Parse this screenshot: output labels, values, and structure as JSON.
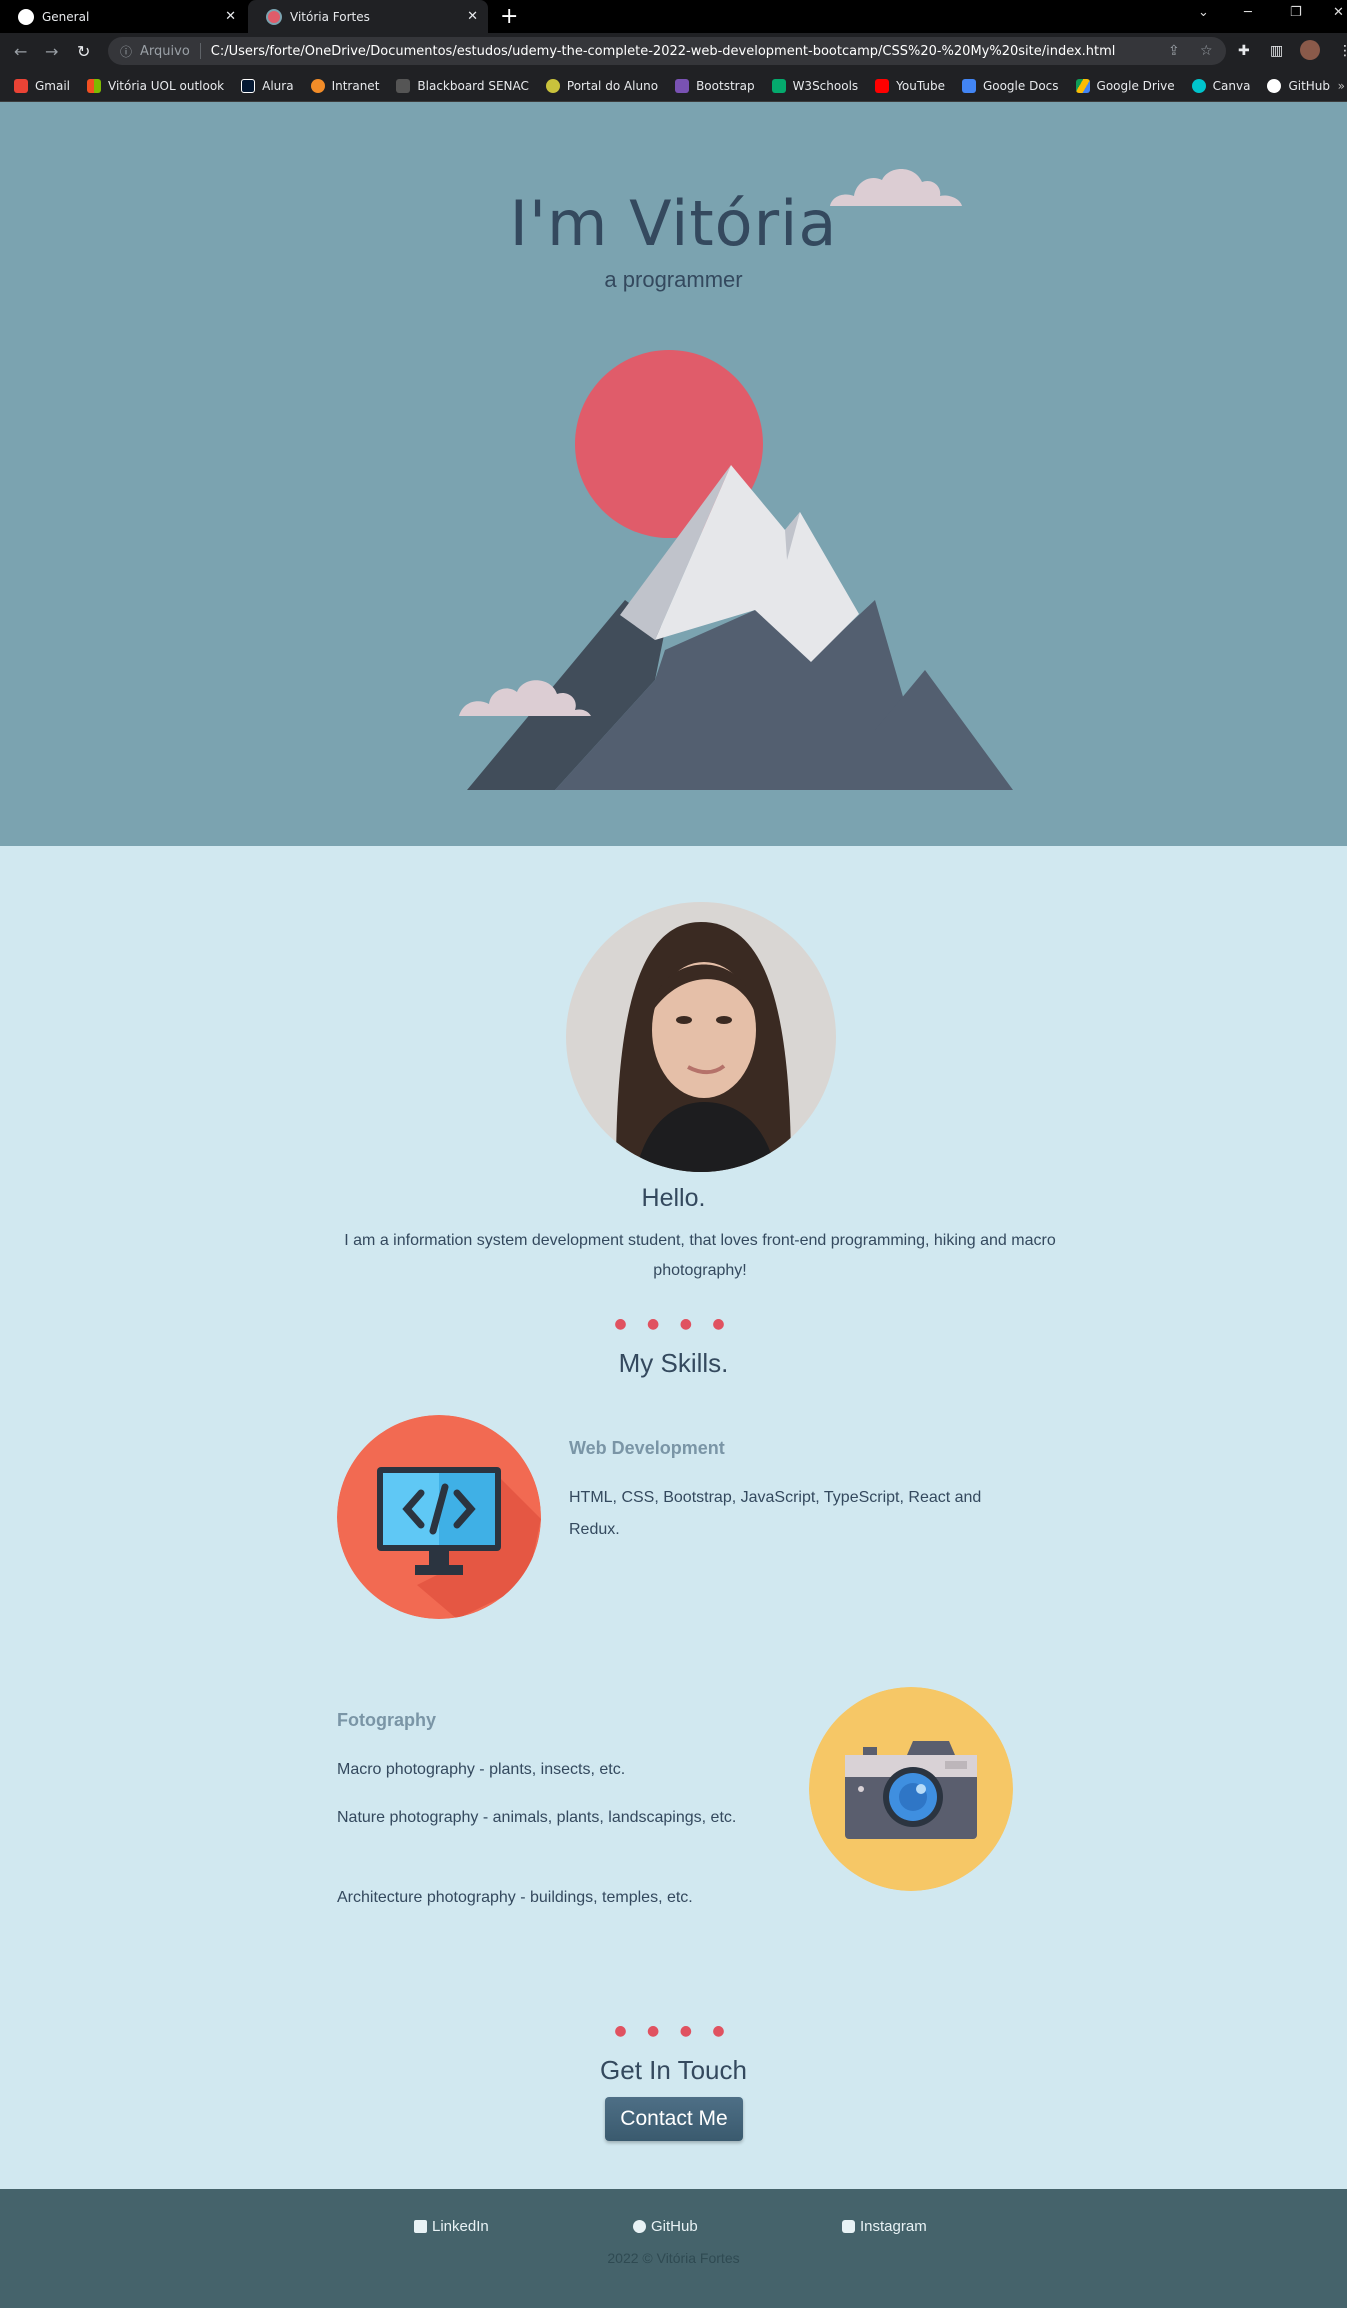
{
  "browser": {
    "tabs": [
      {
        "title": "General",
        "active": false
      },
      {
        "title": "Vitória Fortes",
        "active": true
      }
    ],
    "omnibox": {
      "security_label": "Arquivo",
      "url": "C:/Users/forte/OneDrive/Documentos/estudos/udemy-the-complete-2022-web-development-bootcamp/CSS%20-%20My%20site/index.html"
    },
    "bookmarks": [
      {
        "label": "Gmail",
        "icon": "gmail-icon",
        "color": "#ea4335"
      },
      {
        "label": "Vitória UOL outlook",
        "icon": "microsoft-icon",
        "color": "#f25022"
      },
      {
        "label": "Alura",
        "icon": "alura-icon",
        "color": "#051933"
      },
      {
        "label": "Intranet",
        "icon": "intranet-icon",
        "color": "#f28c28"
      },
      {
        "label": "Blackboard SENAC",
        "icon": "blackboard-icon",
        "color": "#555555"
      },
      {
        "label": "Portal do Aluno",
        "icon": "portal-icon",
        "color": "#c9c23c"
      },
      {
        "label": "Bootstrap",
        "icon": "bootstrap-icon",
        "color": "#7952b3"
      },
      {
        "label": "W3Schools",
        "icon": "w3schools-icon",
        "color": "#04aa6d"
      },
      {
        "label": "YouTube",
        "icon": "youtube-icon",
        "color": "#ff0000"
      },
      {
        "label": "Google Docs",
        "icon": "google-docs-icon",
        "color": "#4285f4"
      },
      {
        "label": "Google Drive",
        "icon": "google-drive-icon",
        "color": "#fbbc04"
      },
      {
        "label": "Canva",
        "icon": "canva-icon",
        "color": "#00c4cc"
      },
      {
        "label": "GitHub",
        "icon": "github-icon",
        "color": "#ffffff"
      }
    ],
    "more_bookmarks": "»"
  },
  "hero": {
    "title": "I'm Vitória",
    "subtitle": "a programmer",
    "colors": {
      "background": "#7ba3b0",
      "sun": "#e05c6a",
      "cloud": "#dccdd3"
    }
  },
  "about": {
    "greeting": "Hello.",
    "intro": "I am a information system development student, that loves front-end programming, hiking and macro photography!"
  },
  "skills": {
    "dots": "● ● ● ●",
    "heading": "My Skills.",
    "items": [
      {
        "title": "Web Development",
        "icon": "computer-code-icon",
        "lines": [
          "HTML, CSS, Bootstrap, JavaScript, TypeScript, React and Redux."
        ]
      },
      {
        "title": "Fotography",
        "icon": "camera-icon",
        "lines": [
          "Macro photography - plants, insects, etc.",
          "Nature photography - animals, plants, landscapings, etc.",
          "Architecture photography - buildings, temples, etc."
        ]
      }
    ]
  },
  "contact": {
    "dots": "● ● ● ●",
    "heading": "Get In Touch",
    "button_label": "Contact Me"
  },
  "footer": {
    "links": [
      {
        "label": "LinkedIn",
        "icon": "linkedin-icon"
      },
      {
        "label": "GitHub",
        "icon": "github-icon"
      },
      {
        "label": "Instagram",
        "icon": "instagram-icon"
      }
    ],
    "copyright": "2022 © Vitória Fortes"
  }
}
